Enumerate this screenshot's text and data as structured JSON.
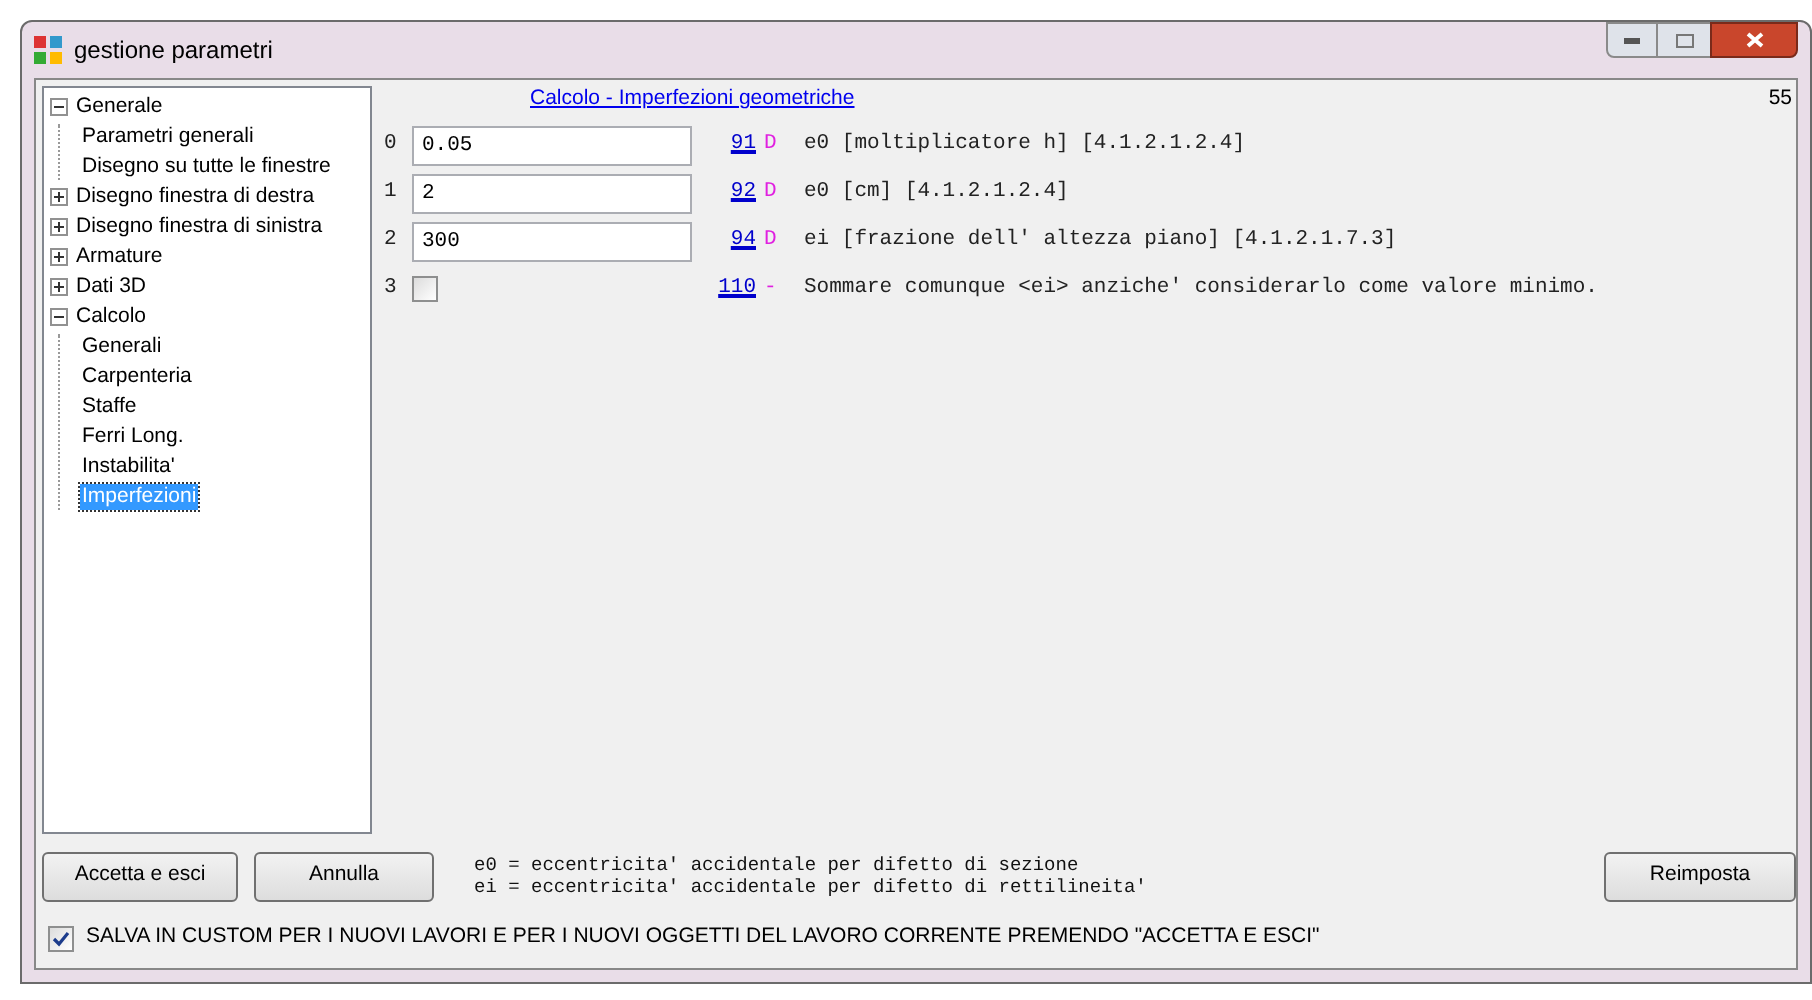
{
  "window": {
    "title": "gestione parametri"
  },
  "tree": [
    {
      "label": "Generale",
      "expanded": true,
      "selected": false,
      "children": [
        {
          "label": "Parametri generali",
          "selected": false
        },
        {
          "label": "Disegno su tutte le finestre",
          "selected": false
        }
      ]
    },
    {
      "label": "Disegno finestra di destra",
      "expanded": false,
      "selected": false
    },
    {
      "label": "Disegno finestra di sinistra",
      "expanded": false,
      "selected": false
    },
    {
      "label": "Armature",
      "expanded": false,
      "selected": false
    },
    {
      "label": "Dati 3D",
      "expanded": false,
      "selected": false
    },
    {
      "label": "Calcolo",
      "expanded": true,
      "selected": false,
      "children": [
        {
          "label": "Generali",
          "selected": false
        },
        {
          "label": "Carpenteria",
          "selected": false
        },
        {
          "label": "Staffe",
          "selected": false
        },
        {
          "label": "Ferri Long.",
          "selected": false
        },
        {
          "label": "Instabilita'",
          "selected": false
        },
        {
          "label": "Imperfezioni",
          "selected": true
        }
      ]
    }
  ],
  "section_link": "Calcolo - Imperfezioni geometriche",
  "corner_number": "55",
  "params": [
    {
      "index": "0",
      "kind": "text",
      "value": "0.05",
      "code": "91",
      "type": "D",
      "description": "e0 [moltiplicatore h] [4.1.2.1.2.4]"
    },
    {
      "index": "1",
      "kind": "text",
      "value": "2",
      "code": "92",
      "type": "D",
      "description": "e0 [cm] [4.1.2.1.2.4]"
    },
    {
      "index": "2",
      "kind": "text",
      "value": "300",
      "code": "94",
      "type": "D",
      "description": "ei [frazione dell' altezza piano] [4.1.2.1.7.3]"
    },
    {
      "index": "3",
      "kind": "checkbox",
      "checked": false,
      "code": "110",
      "type": "-",
      "description": "Sommare comunque <ei> anziche' considerarlo come valore minimo."
    }
  ],
  "buttons": {
    "accept": "Accetta e esci",
    "cancel": "Annulla",
    "reset": "Reimposta"
  },
  "legend": [
    "e0 = eccentricita' accidentale per difetto di sezione",
    "ei = eccentricita' accidentale per difetto di rettilineita'"
  ],
  "save_option": {
    "label": "SALVA IN CUSTOM PER I NUOVI LAVORI E PER I NUOVI OGGETTI DEL LAVORO CORRENTE PREMENDO \"ACCETTA E ESCI\"",
    "checked": true
  }
}
